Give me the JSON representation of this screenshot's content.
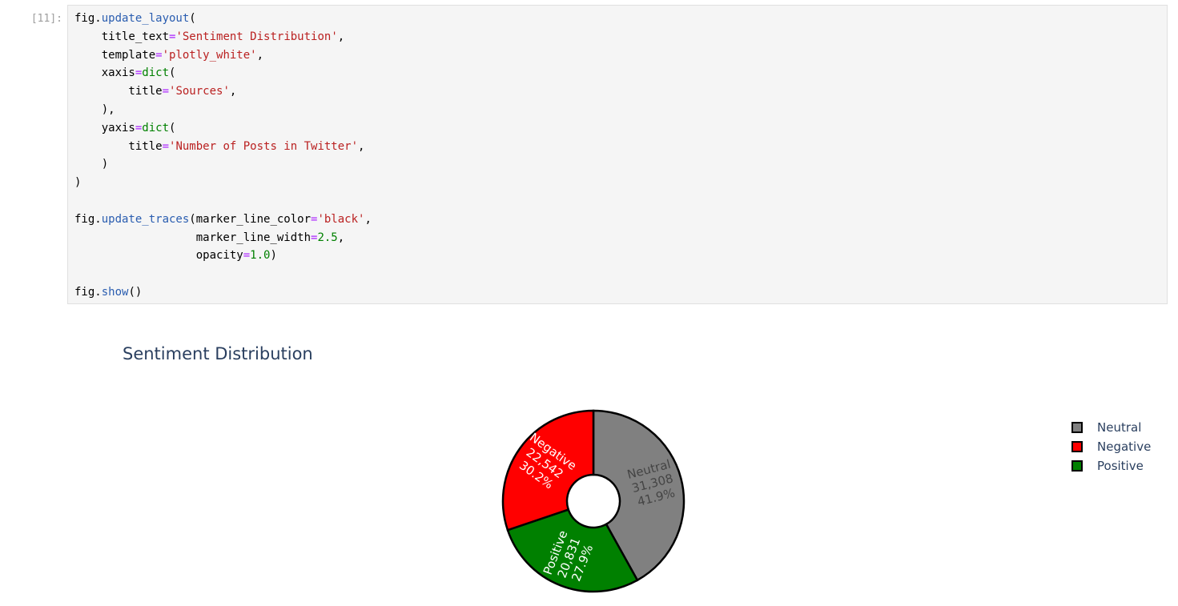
{
  "cell": {
    "prompt": "[11]:",
    "code_lines": [
      [
        {
          "t": "fig."
        },
        {
          "t": "update_layout",
          "c": "f"
        },
        {
          "t": "("
        }
      ],
      [
        {
          "t": "    title_text"
        },
        {
          "t": "=",
          "c": "o"
        },
        {
          "t": "'Sentiment Distribution'",
          "c": "s"
        },
        {
          "t": ","
        }
      ],
      [
        {
          "t": "    template"
        },
        {
          "t": "=",
          "c": "o"
        },
        {
          "t": "'plotly_white'",
          "c": "s"
        },
        {
          "t": ","
        }
      ],
      [
        {
          "t": "    xaxis"
        },
        {
          "t": "=",
          "c": "o"
        },
        {
          "t": "dict",
          "c": "n"
        },
        {
          "t": "("
        }
      ],
      [
        {
          "t": "        title"
        },
        {
          "t": "=",
          "c": "o"
        },
        {
          "t": "'Sources'",
          "c": "s"
        },
        {
          "t": ","
        }
      ],
      [
        {
          "t": "    ),"
        }
      ],
      [
        {
          "t": "    yaxis"
        },
        {
          "t": "=",
          "c": "o"
        },
        {
          "t": "dict",
          "c": "n"
        },
        {
          "t": "("
        }
      ],
      [
        {
          "t": "        title"
        },
        {
          "t": "=",
          "c": "o"
        },
        {
          "t": "'Number of Posts in Twitter'",
          "c": "s"
        },
        {
          "t": ","
        }
      ],
      [
        {
          "t": "    )"
        }
      ],
      [
        {
          "t": ")"
        }
      ],
      [],
      [
        {
          "t": "fig."
        },
        {
          "t": "update_traces",
          "c": "f"
        },
        {
          "t": "(marker_line_color"
        },
        {
          "t": "=",
          "c": "o"
        },
        {
          "t": "'black'",
          "c": "s"
        },
        {
          "t": ","
        }
      ],
      [
        {
          "t": "                  marker_line_width"
        },
        {
          "t": "=",
          "c": "o"
        },
        {
          "t": "2.5",
          "c": "n"
        },
        {
          "t": ","
        }
      ],
      [
        {
          "t": "                  opacity"
        },
        {
          "t": "=",
          "c": "o"
        },
        {
          "t": "1.0",
          "c": "n"
        },
        {
          "t": ")"
        }
      ],
      [],
      [
        {
          "t": "fig."
        },
        {
          "t": "show",
          "c": "f"
        },
        {
          "t": "()"
        }
      ]
    ]
  },
  "chart_data": {
    "type": "pie",
    "title": "Sentiment Distribution",
    "hole": true,
    "legend_placement": "top-right",
    "slices": [
      {
        "label": "Neutral",
        "value": 31308,
        "value_text": "31,308",
        "percent_text": "41.9%",
        "color": "#808080",
        "text_color": "#444444"
      },
      {
        "label": "Positive",
        "value": 20831,
        "value_text": "20,831",
        "percent_text": "27.9%",
        "color": "#008000",
        "text_color": "#ffffff"
      },
      {
        "label": "Negative",
        "value": 22542,
        "value_text": "22,542",
        "percent_text": "30.2%",
        "color": "#ff0000",
        "text_color": "#ffffff"
      }
    ],
    "legend": [
      {
        "label": "Neutral",
        "color": "#808080"
      },
      {
        "label": "Negative",
        "color": "#ff0000"
      },
      {
        "label": "Positive",
        "color": "#008000"
      }
    ],
    "line_color": "#000000"
  }
}
